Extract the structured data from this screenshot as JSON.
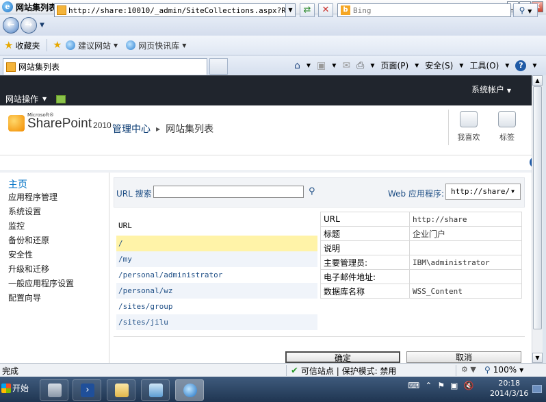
{
  "window": {
    "title": "网站集列表 - Windows Internet Explorer",
    "minimize": "_",
    "maximize": "□",
    "close": "X"
  },
  "addressbar": {
    "url": "http://share:10010/_admin/SiteCollections.aspx?Retur",
    "search_placeholder": "Bing"
  },
  "favorites": {
    "label": "收藏夹",
    "items": [
      "建议网站",
      "网页快讯库"
    ]
  },
  "tab": {
    "title": "网站集列表"
  },
  "commands": {
    "page": "页面(P)",
    "safety": "安全(S)",
    "tools": "工具(O)"
  },
  "sharepoint": {
    "site_actions": "网站操作",
    "account": "系统帐户",
    "logo_ms": "Microsoft®",
    "logo_name": "SharePoint",
    "logo_version": "2010",
    "breadcrumb": [
      "管理中心",
      "网站集列表"
    ],
    "actions": [
      "我喜欢",
      "标签"
    ]
  },
  "leftnav": {
    "home": "主页",
    "items": [
      "应用程序管理",
      "系统设置",
      "监控",
      "备份和还原",
      "安全性",
      "升级和迁移",
      "一般应用程序设置",
      "配置向导"
    ]
  },
  "filter": {
    "url_search_label": "URL 搜索",
    "url_search_value": "",
    "web_app_label": "Web 应用程序:",
    "web_app_value": "http://share/"
  },
  "url_list": {
    "header": "URL",
    "rows": [
      "/",
      "/my",
      "/personal/administrator",
      "/personal/wz",
      "/sites/group",
      "/sites/jilu"
    ]
  },
  "properties": [
    {
      "key": "URL",
      "value": "http://share"
    },
    {
      "key": "标题",
      "value": "企业门户"
    },
    {
      "key": "说明",
      "value": ""
    },
    {
      "key": "主要管理员:",
      "value": "IBM\\administrator"
    },
    {
      "key": "电子邮件地址:",
      "value": ""
    },
    {
      "key": "数据库名称",
      "value": "WSS_Content"
    }
  ],
  "buttons": {
    "ok": "确定",
    "cancel": "取消"
  },
  "statusbar": {
    "status": "完成",
    "zone": "可信站点 | 保护模式: 禁用",
    "zoom": "100%"
  },
  "taskbar": {
    "start": "开始",
    "time": "20:18",
    "date": "2014/3/16"
  }
}
